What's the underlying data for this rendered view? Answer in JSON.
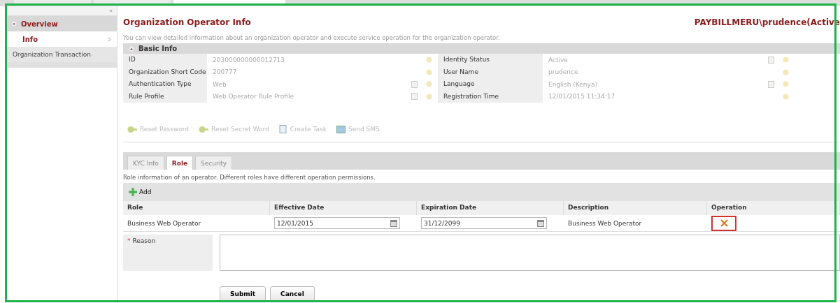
{
  "top_tabs": [
    {
      "selected": false
    },
    {
      "selected": false
    },
    {
      "selected": true
    }
  ],
  "sidebar": {
    "collapse": "«",
    "items": [
      {
        "label": "Overview",
        "kind": "group",
        "children": [
          {
            "label": "Info",
            "kind": "item",
            "selected": true
          }
        ]
      },
      {
        "label": "Organization Transaction",
        "kind": "item",
        "selected": false
      }
    ]
  },
  "page": {
    "title": "Organization Operator Info",
    "operator": "PAYBILLMERU\\prudence(Active",
    "description": "You can view detailed information about an organization operator and execute service operation for the organization operator."
  },
  "basic_info": {
    "title": "Basic Info",
    "rows": [
      [
        {
          "label": "ID",
          "value": "203000000000012713",
          "editable": false
        },
        {
          "label": "Identity Status",
          "value": "Active",
          "editable": true
        }
      ],
      [
        {
          "label": "Organization Short Code",
          "value": "200777",
          "editable": false
        },
        {
          "label": "User Name",
          "value": "prudence",
          "editable": false
        }
      ],
      [
        {
          "label": "Authentication Type",
          "value": "Web",
          "editable": true
        },
        {
          "label": "Language",
          "value": "English (Kenya)",
          "editable": true
        }
      ],
      [
        {
          "label": "Rule Profile",
          "value": "Web Operator Rule Profile",
          "editable": true
        },
        {
          "label": "Registration Time",
          "value": "12/01/2015 11:34:17",
          "editable": false
        }
      ]
    ]
  },
  "actions": [
    {
      "label": "Reset Password",
      "kind": "key",
      "disabled": true
    },
    {
      "label": "Reset Secret Word",
      "kind": "key",
      "disabled": true
    },
    {
      "label": "Create Task",
      "kind": "task",
      "disabled": true
    },
    {
      "label": "Send SMS",
      "kind": "sms",
      "disabled": true
    }
  ],
  "tabs": [
    {
      "label": "KYC Info",
      "selected": false,
      "disabled": true
    },
    {
      "label": "Role",
      "selected": true,
      "disabled": false
    },
    {
      "label": "Security",
      "selected": false,
      "disabled": true
    }
  ],
  "role": {
    "description": "Role information of an operator. Different roles have different operation permissions.",
    "add": "Add",
    "columns": [
      "Role",
      "Effective Date",
      "Expiration Date",
      "Description",
      "Operation"
    ],
    "rows": [
      {
        "role": "Business Web Operator",
        "effective": "12/01/2015",
        "expiration": "31/12/2099",
        "description": "Business Web Operator",
        "highlighted": true
      }
    ]
  },
  "reason": {
    "label": "Reason",
    "required_mark": "*"
  },
  "buttons": [
    "Submit",
    "Cancel"
  ]
}
